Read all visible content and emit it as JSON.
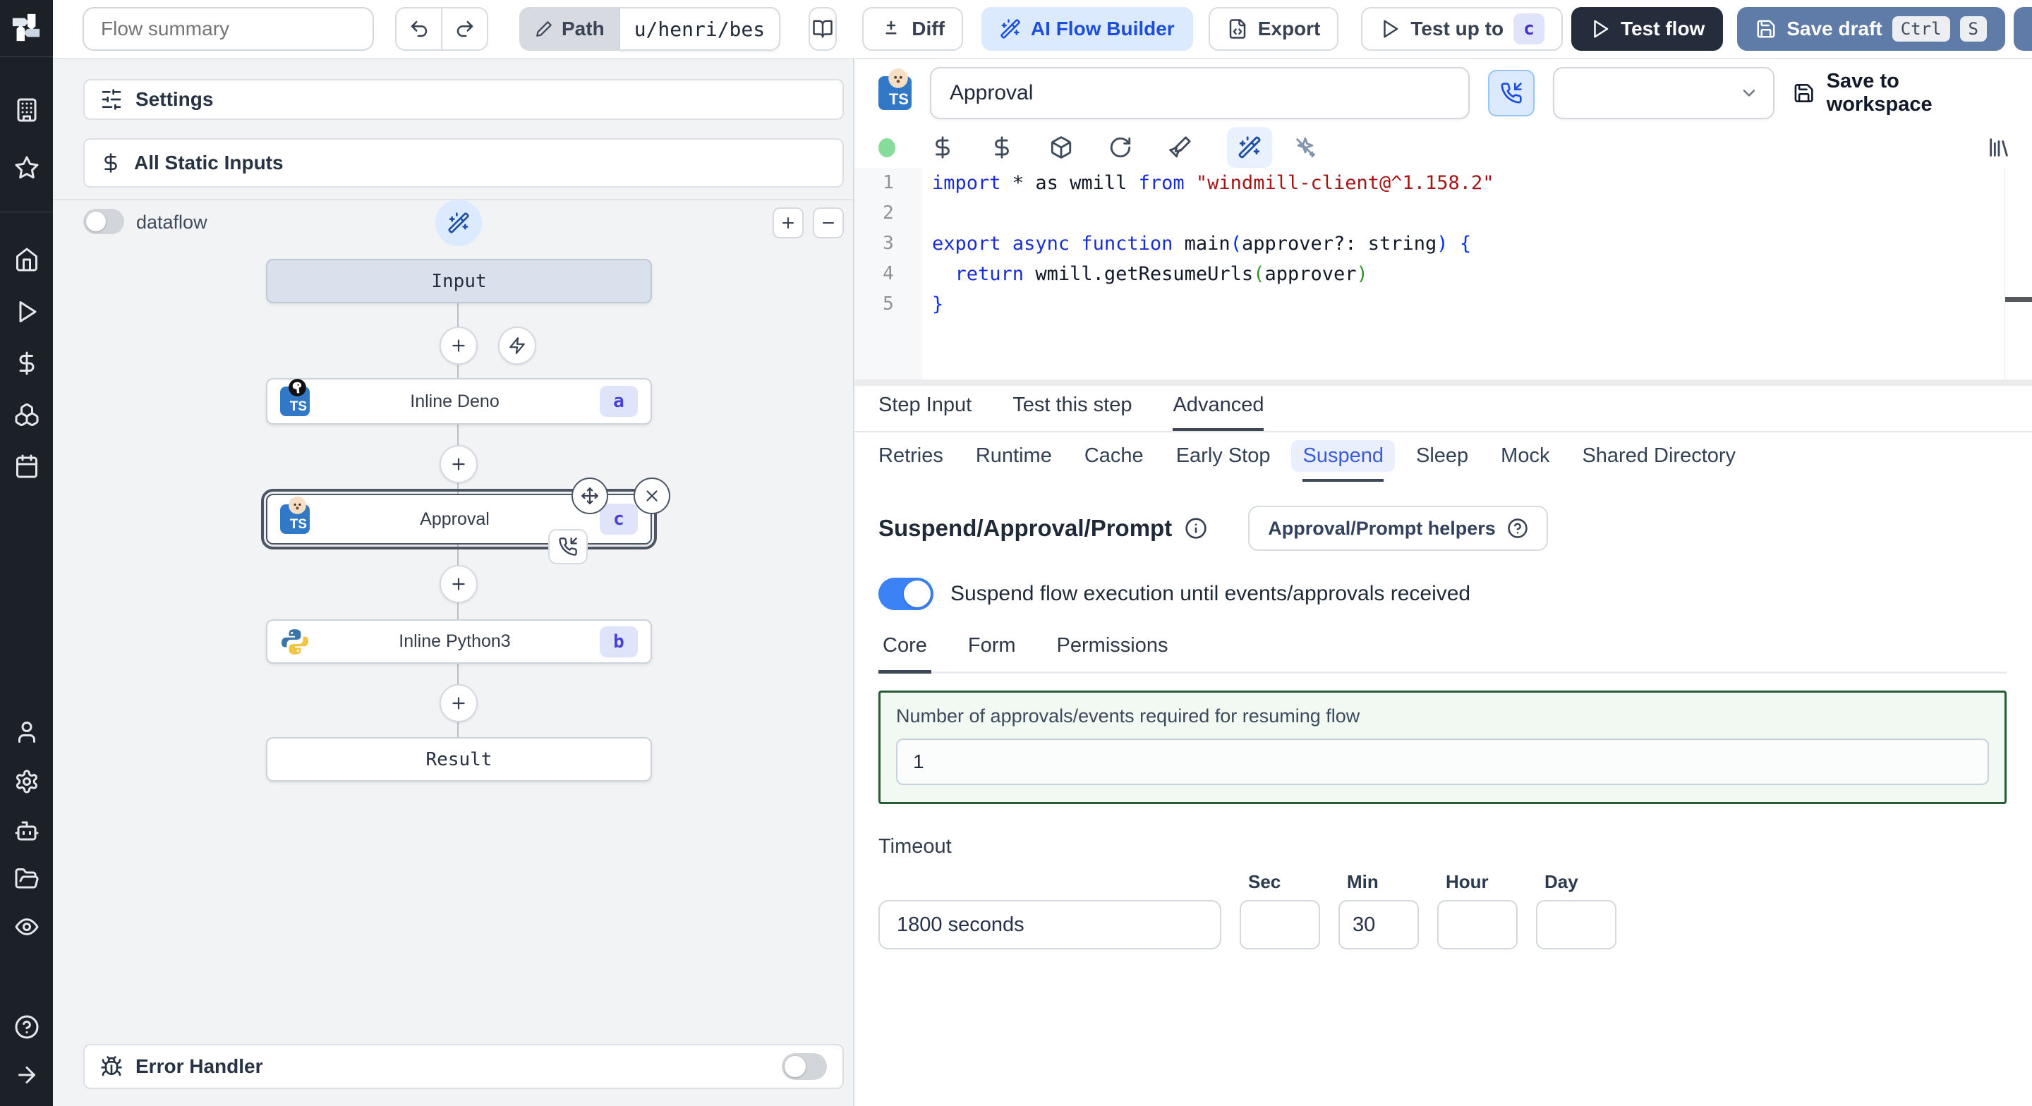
{
  "toolbar": {
    "flow_summary_placeholder": "Flow summary",
    "path_label": "Path",
    "path_value": "u/henri/bes",
    "diff_label": "Diff",
    "ai_flow_builder_label": "AI Flow Builder",
    "export_label": "Export",
    "test_up_to_label": "Test up to",
    "test_up_to_badge": "c",
    "test_flow_label": "Test flow",
    "save_draft_label": "Save draft",
    "kbd_ctrl": "Ctrl",
    "kbd_s": "S"
  },
  "flow_panel": {
    "settings_label": "Settings",
    "static_inputs_label": "All Static Inputs",
    "dataflow_label": "dataflow",
    "graph": {
      "input_label": "Input",
      "steps": [
        {
          "label": "Inline Deno",
          "badge": "a"
        },
        {
          "label": "Approval",
          "badge": "c"
        },
        {
          "label": "Inline Python3",
          "badge": "b"
        }
      ],
      "result_label": "Result"
    },
    "error_handler_label": "Error Handler"
  },
  "step_panel": {
    "name_value": "Approval",
    "save_to_workspace_label": "Save to workspace",
    "code": {
      "lines": [
        [
          {
            "c": "k",
            "t": "import"
          },
          {
            "c": "p",
            "t": " * as wmill "
          },
          {
            "c": "k",
            "t": "from"
          },
          {
            "c": "s",
            "t": " \"windmill-client@^1.158.2\""
          }
        ],
        [],
        [
          {
            "c": "k",
            "t": "export"
          },
          {
            "c": "p",
            "t": " "
          },
          {
            "c": "k",
            "t": "async"
          },
          {
            "c": "p",
            "t": " "
          },
          {
            "c": "k",
            "t": "function"
          },
          {
            "c": "p",
            "t": " main"
          },
          {
            "c": "b",
            "t": "("
          },
          {
            "c": "p",
            "t": "approver?: string"
          },
          {
            "c": "b",
            "t": ")"
          },
          {
            "c": "p",
            "t": " "
          },
          {
            "c": "b",
            "t": "{"
          }
        ],
        [
          {
            "c": "p",
            "t": "  "
          },
          {
            "c": "k",
            "t": "return"
          },
          {
            "c": "p",
            "t": " wmill.getResumeUrls"
          },
          {
            "c": "g",
            "t": "("
          },
          {
            "c": "p",
            "t": "approver"
          },
          {
            "c": "g",
            "t": ")"
          }
        ],
        [
          {
            "c": "b",
            "t": "}"
          }
        ]
      ]
    },
    "tabs": {
      "items": [
        "Step Input",
        "Test this step",
        "Advanced"
      ],
      "active": "Advanced"
    },
    "advanced_tabs": {
      "items": [
        "Retries",
        "Runtime",
        "Cache",
        "Early Stop",
        "Suspend",
        "Sleep",
        "Mock",
        "Shared Directory"
      ],
      "active": "Suspend"
    },
    "suspend": {
      "title": "Suspend/Approval/Prompt",
      "helpers_button_label": "Approval/Prompt helpers",
      "toggle_label": "Suspend flow execution until events/approvals received",
      "toggle_on": true,
      "subtabs": {
        "items": [
          "Core",
          "Form",
          "Permissions"
        ],
        "active": "Core"
      },
      "approvals_label": "Number of approvals/events required for resuming flow",
      "approvals_value": "1",
      "timeout_label": "Timeout",
      "timeout_value": "1800 seconds",
      "unit_labels": [
        "Sec",
        "Min",
        "Hour",
        "Day"
      ],
      "unit_values": [
        "",
        "30",
        "",
        ""
      ]
    }
  },
  "colors": {
    "accent_blue": "#3b82f6",
    "ai_button_bg": "#dbeafe",
    "save_draft_bg": "#5f7ca8",
    "test_flow_bg": "#252d3d",
    "approvals_box_border": "#265c33",
    "badge_bg": "#e0e4fb",
    "badge_text": "#4740d4",
    "status_dot": "#86dd9b"
  }
}
